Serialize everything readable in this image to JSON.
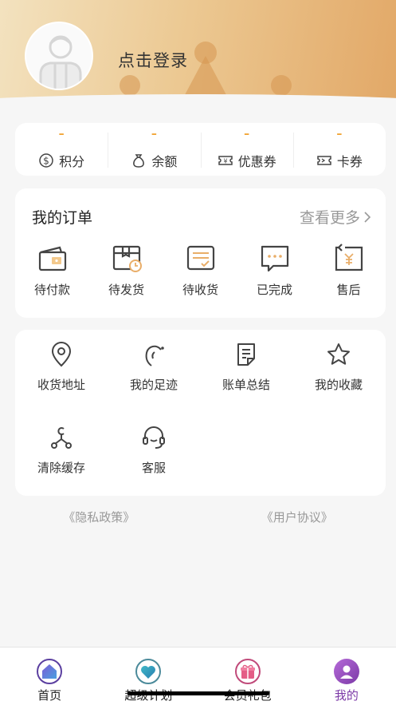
{
  "header": {
    "login_text": "点击登录"
  },
  "stats": [
    {
      "value": "–",
      "label": "积分",
      "icon": "dollar-circle-icon"
    },
    {
      "value": "–",
      "label": "余额",
      "icon": "money-bag-icon"
    },
    {
      "value": "–",
      "label": "优惠券",
      "icon": "yen-ticket-icon"
    },
    {
      "value": "–",
      "label": "卡券",
      "icon": "card-ticket-icon"
    }
  ],
  "orders": {
    "title": "我的订单",
    "more": "查看更多",
    "items": [
      {
        "label": "待付款",
        "icon": "wallet-icon"
      },
      {
        "label": "待发货",
        "icon": "package-clock-icon"
      },
      {
        "label": "待收货",
        "icon": "receive-box-icon"
      },
      {
        "label": "已完成",
        "icon": "chat-dots-icon"
      },
      {
        "label": "售后",
        "icon": "refund-icon"
      }
    ]
  },
  "tools": [
    {
      "label": "收货地址",
      "icon": "location-pin-icon"
    },
    {
      "label": "我的足迹",
      "icon": "footprint-icon"
    },
    {
      "label": "账单总结",
      "icon": "bill-icon"
    },
    {
      "label": "我的收藏",
      "icon": "star-icon"
    },
    {
      "label": "清除缓存",
      "icon": "share-nodes-icon"
    },
    {
      "label": "客服",
      "icon": "headset-icon"
    }
  ],
  "links": {
    "privacy": "《隐私政策》",
    "agreement": "《用户协议》"
  },
  "tabbar": [
    {
      "label": "首页",
      "icon": "home-icon"
    },
    {
      "label": "超级计划",
      "icon": "heart-icon"
    },
    {
      "label": "会员礼包",
      "icon": "gift-icon"
    },
    {
      "label": "我的",
      "icon": "user-icon"
    }
  ],
  "colors": {
    "accent": "#f1a230",
    "active_tab": "#7c3aa7",
    "header_start": "#f3e2bf",
    "header_end": "#e2a867"
  }
}
